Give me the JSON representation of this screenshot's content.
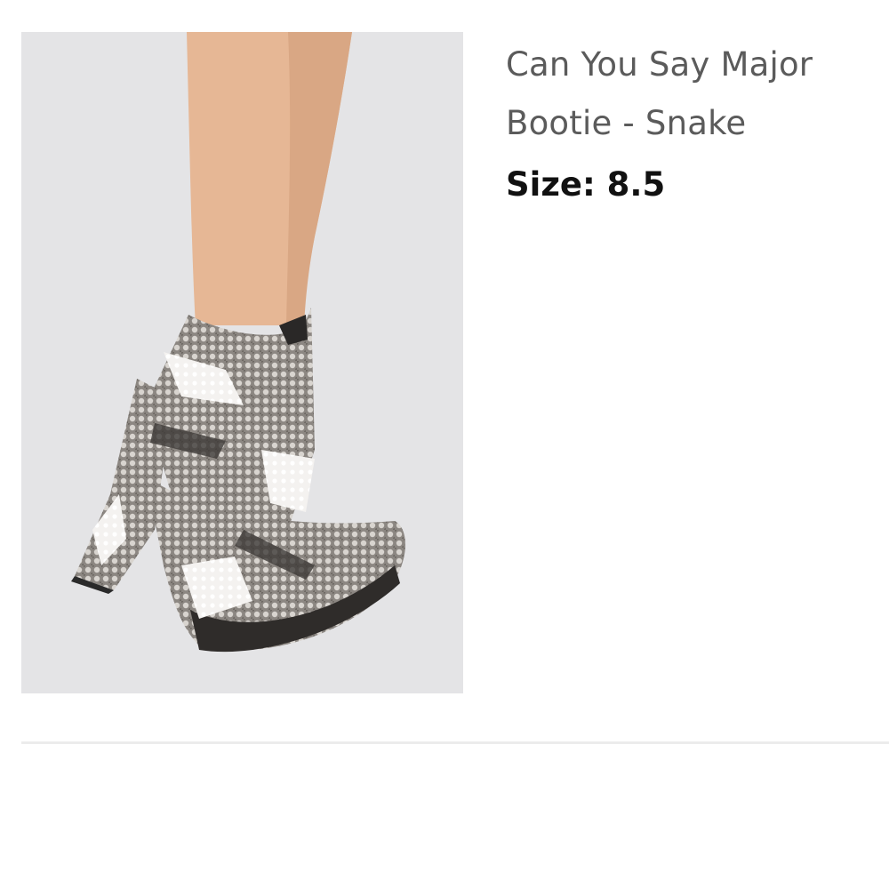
{
  "product": {
    "title": "Can You Say Major Bootie - Snake",
    "size_label": "Size:",
    "size_value": "8.5",
    "image_icon": "product-photo-snake-print-platform-bootie"
  },
  "colors": {
    "title_text": "#5b5b5b",
    "size_text": "#111111",
    "image_background": "#e4e4e6",
    "divider": "#ececec"
  }
}
